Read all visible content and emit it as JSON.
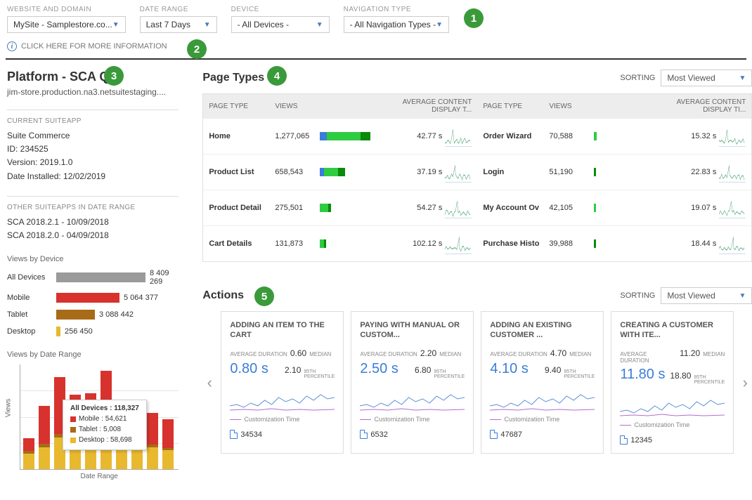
{
  "filters": {
    "website": {
      "label": "WEBSITE AND DOMAIN",
      "value": "MySite - Samplestore.co..."
    },
    "daterange": {
      "label": "DATE RANGE",
      "value": "Last 7 Days"
    },
    "device": {
      "label": "DEVICE",
      "value": "- All Devices -"
    },
    "navtype": {
      "label": "NAVIGATION TYPE",
      "value": "- All Navigation Types -"
    }
  },
  "info_link": "CLICK HERE FOR MORE INFORMATION",
  "sidebar": {
    "title": "Platform - SCA QA",
    "subtitle": "jim-store.production.na3.netsuitestaging....",
    "current": {
      "head": "CURRENT SUITEAPP",
      "name": "Suite Commerce",
      "id": "ID: 234525",
      "version": "Version: 2019.1.0",
      "installed": "Date Installed: 12/02/2019"
    },
    "other": {
      "head": "OTHER SUITEAPPS IN DATE RANGE",
      "r1": "SCA 2018.2.1 - 10/09/2018",
      "r2": "SCA 2018.2.0 - 04/09/2018"
    },
    "vbd": {
      "head": "Views by Device",
      "rows": [
        {
          "label": "All Devices",
          "value": "8 409 269",
          "width": 150,
          "color": "#9a9a9a"
        },
        {
          "label": "Mobile",
          "value": "5 064 377",
          "width": 90,
          "color": "#d8322e"
        },
        {
          "label": "Tablet",
          "value": "3 088 442",
          "width": 55,
          "color": "#a86b18"
        },
        {
          "label": "Desktop",
          "value": "256 450",
          "width": 6,
          "color": "#e8b92e"
        }
      ]
    },
    "vdr": {
      "head": "Views by Date Range",
      "ylabel": "Views",
      "xlabel": "Date Range",
      "tooltip": {
        "title": "All Devices : 118,327",
        "mobile": "Mobile :   54,621",
        "tablet": "Tablet :    5,008",
        "desktop": "Desktop :  58,698"
      }
    }
  },
  "pagetypes": {
    "title": "Page Types",
    "sort_label": "SORTING",
    "sort_value": "Most Viewed",
    "headers": {
      "page": "PAGE TYPE",
      "views": "VIEWS",
      "avg": "AVERAGE CONTENT DISPLAY T...",
      "avg2": "AVERAGE CONTENT DISPLAY TI..."
    },
    "left": [
      {
        "page": "Home",
        "views": "1,277,065",
        "time": "42.77 s",
        "bar": [
          {
            "c": "#3b7dd8",
            "w": 10
          },
          {
            "c": "#2ecc40",
            "w": 48
          },
          {
            "c": "#0a8a0a",
            "w": 14
          }
        ]
      },
      {
        "page": "Product List",
        "views": "658,543",
        "time": "37.19 s",
        "bar": [
          {
            "c": "#3b7dd8",
            "w": 6
          },
          {
            "c": "#2ecc40",
            "w": 20
          },
          {
            "c": "#0a8a0a",
            "w": 10
          }
        ]
      },
      {
        "page": "Product Detail",
        "views": "275,501",
        "time": "54.27 s",
        "bar": [
          {
            "c": "#2ecc40",
            "w": 12
          },
          {
            "c": "#0a8a0a",
            "w": 4
          }
        ]
      },
      {
        "page": "Cart Details",
        "views": "131,873",
        "time": "102.12 s",
        "bar": [
          {
            "c": "#2ecc40",
            "w": 6
          },
          {
            "c": "#0a8a0a",
            "w": 3
          }
        ]
      }
    ],
    "right": [
      {
        "page": "Order Wizard",
        "views": "70,588",
        "time": "15.32 s",
        "bar": [
          {
            "c": "#2ecc40",
            "w": 4
          }
        ]
      },
      {
        "page": "Login",
        "views": "51,190",
        "time": "22.83 s",
        "bar": [
          {
            "c": "#0a8a0a",
            "w": 3
          }
        ]
      },
      {
        "page": "My Account Ov",
        "views": "42,105",
        "time": "19.07 s",
        "bar": [
          {
            "c": "#2ecc40",
            "w": 3
          }
        ]
      },
      {
        "page": "Purchase Histo",
        "views": "39,988",
        "time": "18.44 s",
        "bar": [
          {
            "c": "#0a8a0a",
            "w": 3
          }
        ]
      }
    ]
  },
  "actions": {
    "title": "Actions",
    "sort_label": "SORTING",
    "sort_value": "Most Viewed",
    "legend": "Customization Time",
    "avgdur_label": "AVERAGE DURATION",
    "median_label": "MEDIAN",
    "pct_label": "95TH PERCENTILE",
    "cards": [
      {
        "title": "ADDING AN ITEM TO THE CART",
        "avg": "0.60",
        "big": "0.80 s",
        "pct": "2.10",
        "count": "34534"
      },
      {
        "title": "PAYING WITH MANUAL OR CUSTOM...",
        "avg": "2.20",
        "big": "2.50 s",
        "pct": "6.80",
        "count": "6532"
      },
      {
        "title": "ADDING AN EXISTING CUSTOMER ...",
        "avg": "4.70",
        "big": "4.10 s",
        "pct": "9.40",
        "count": "47687"
      },
      {
        "title": "CREATING A CUSTOMER WITH ITE...",
        "avg": "11.20",
        "big": "11.80 s",
        "pct": "18.80",
        "count": "12345"
      }
    ]
  },
  "callouts": {
    "c1": "1",
    "c2": "2",
    "c3": "3",
    "c4": "4",
    "c5": "5"
  },
  "chart_data": {
    "views_by_device": {
      "type": "bar",
      "categories": [
        "All Devices",
        "Mobile",
        "Tablet",
        "Desktop"
      ],
      "values": [
        8409269,
        5064377,
        3088442,
        256450
      ]
    },
    "views_by_date_range": {
      "type": "bar",
      "xlabel": "Date Range",
      "ylabel": "Views",
      "series": [
        {
          "name": "Mobile",
          "color": "#d8322e",
          "values": [
            20000,
            60000,
            90000,
            54621,
            70000,
            95000,
            30000,
            60000,
            50000,
            45000
          ]
        },
        {
          "name": "Tablet",
          "color": "#a86b18",
          "values": [
            4000,
            5000,
            6000,
            5008,
            5500,
            6000,
            4000,
            5000,
            4500,
            4000
          ]
        },
        {
          "name": "Desktop",
          "color": "#e8b92e",
          "values": [
            25000,
            35000,
            50000,
            58698,
            45000,
            55000,
            30000,
            40000,
            35000,
            30000
          ]
        }
      ],
      "tooltip_index": 3,
      "tooltip_total": 118327
    }
  }
}
